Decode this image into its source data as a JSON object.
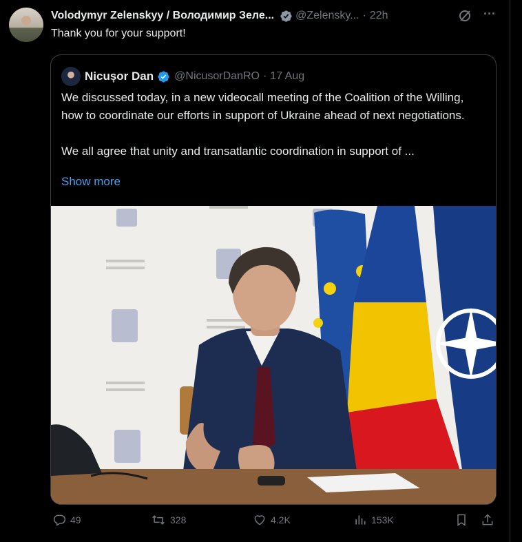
{
  "tweet": {
    "author_name": "Volodymyr Zelenskyy / Володимир Зеле...",
    "handle": "@Zelensky...",
    "dot": "·",
    "time": "22h",
    "text": "Thank you for your support!"
  },
  "quoted": {
    "author_name": "Nicușor Dan",
    "handle": "@NicusorDanRO",
    "dot": "·",
    "date": "17 Aug",
    "paragraph1": "We discussed today, in a new videocall meeting of the Coalition of the Willing, how to coordinate our efforts in support of Ukraine ahead of next negotiations.",
    "paragraph2": "We all agree that unity and transatlantic coordination in support of ...",
    "show_more": "Show more"
  },
  "actions": {
    "replies": "49",
    "reposts": "328",
    "likes": "4.2K",
    "views": "153K"
  },
  "colors": {
    "background": "#000000",
    "text": "#e7e9ea",
    "secondary": "#71767b",
    "link": "#4c9eeb",
    "verified": "#1d9bf0"
  },
  "icons": [
    "verified-badge-icon",
    "grok-icon",
    "more-icon",
    "reply-icon",
    "repost-icon",
    "like-icon",
    "views-icon",
    "bookmark-icon",
    "share-icon"
  ]
}
